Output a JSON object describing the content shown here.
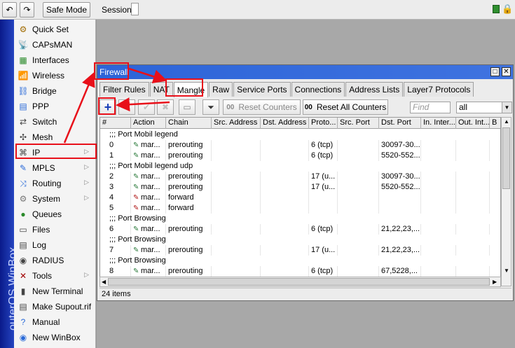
{
  "topbar": {
    "undo_icon": "undo-icon",
    "redo_icon": "redo-icon",
    "safe_mode": "Safe Mode",
    "session_label": "Session:"
  },
  "brand_vertical": "outerOS WinBox",
  "sidebar": {
    "items": [
      {
        "label": "Quick Set",
        "icon": "quickset-icon",
        "arrow": false
      },
      {
        "label": "CAPsMAN",
        "icon": "capsman-icon",
        "arrow": false
      },
      {
        "label": "Interfaces",
        "icon": "interfaces-icon",
        "arrow": false
      },
      {
        "label": "Wireless",
        "icon": "wireless-icon",
        "arrow": false
      },
      {
        "label": "Bridge",
        "icon": "bridge-icon",
        "arrow": false
      },
      {
        "label": "PPP",
        "icon": "ppp-icon",
        "arrow": false
      },
      {
        "label": "Switch",
        "icon": "switch-icon",
        "arrow": false
      },
      {
        "label": "Mesh",
        "icon": "mesh-icon",
        "arrow": false
      },
      {
        "label": "IP",
        "icon": "ip-icon",
        "arrow": true
      },
      {
        "label": "MPLS",
        "icon": "mpls-icon",
        "arrow": true
      },
      {
        "label": "Routing",
        "icon": "routing-icon",
        "arrow": true
      },
      {
        "label": "System",
        "icon": "system-icon",
        "arrow": true
      },
      {
        "label": "Queues",
        "icon": "queues-icon",
        "arrow": false
      },
      {
        "label": "Files",
        "icon": "files-icon",
        "arrow": false
      },
      {
        "label": "Log",
        "icon": "log-icon",
        "arrow": false
      },
      {
        "label": "RADIUS",
        "icon": "radius-icon",
        "arrow": false
      },
      {
        "label": "Tools",
        "icon": "tools-icon",
        "arrow": true
      },
      {
        "label": "New Terminal",
        "icon": "terminal-icon",
        "arrow": false
      },
      {
        "label": "Make Supout.rif",
        "icon": "supout-icon",
        "arrow": false
      },
      {
        "label": "Manual",
        "icon": "manual-icon",
        "arrow": false
      },
      {
        "label": "New WinBox",
        "icon": "winbox-icon",
        "arrow": false
      }
    ]
  },
  "window": {
    "title": "Firewall",
    "tabs": [
      "Filter Rules",
      "NAT",
      "Mangle",
      "Raw",
      "Service Ports",
      "Connections",
      "Address Lists",
      "Layer7 Protocols"
    ],
    "active_tab": "Mangle",
    "toolbar": {
      "reset_counters": "Reset Counters",
      "reset_all_counters": "Reset All Counters",
      "counter_prefix": "00",
      "find_placeholder": "Find",
      "chain_filter": "all"
    },
    "columns": [
      "#",
      "Action",
      "Chain",
      "Src. Address",
      "Dst. Address",
      "Proto...",
      "Src. Port",
      "Dst. Port",
      "In. Inter...",
      "Out. Int...",
      "B"
    ],
    "rows": [
      {
        "comment": ";;; Port Mobil legend"
      },
      {
        "num": "0",
        "action": "mar...",
        "chain": "prerouting",
        "proto": "6 (tcp)",
        "dst_port": "30097-30...",
        "icon": "enabled"
      },
      {
        "num": "1",
        "action": "mar...",
        "chain": "prerouting",
        "proto": "6 (tcp)",
        "dst_port": "5520-552...",
        "icon": "enabled"
      },
      {
        "comment": ";;; Port Mobil legend udp"
      },
      {
        "num": "2",
        "action": "mar...",
        "chain": "prerouting",
        "proto": "17 (u...",
        "dst_port": "30097-30...",
        "icon": "enabled"
      },
      {
        "num": "3",
        "action": "mar...",
        "chain": "prerouting",
        "proto": "17 (u...",
        "dst_port": "5520-552...",
        "icon": "enabled"
      },
      {
        "num": "4",
        "action": "mar...",
        "chain": "forward",
        "proto": "",
        "dst_port": "",
        "icon": "red"
      },
      {
        "num": "5",
        "action": "mar...",
        "chain": "forward",
        "proto": "",
        "dst_port": "",
        "icon": "red"
      },
      {
        "comment": ";;; Port Browsing"
      },
      {
        "num": "6",
        "action": "mar...",
        "chain": "prerouting",
        "proto": "6 (tcp)",
        "dst_port": "21,22,23,...",
        "icon": "enabled"
      },
      {
        "comment": ";;; Port Browsing"
      },
      {
        "num": "7",
        "action": "mar...",
        "chain": "prerouting",
        "proto": "17 (u...",
        "dst_port": "21,22,23,...",
        "icon": "enabled"
      },
      {
        "comment": ";;; Port Browsing"
      },
      {
        "num": "8",
        "action": "mar...",
        "chain": "prerouting",
        "proto": "6 (tcp)",
        "dst_port": "67,5228,...",
        "icon": "enabled"
      }
    ],
    "status": "24 items"
  },
  "colors": {
    "highlight": "#e8101a",
    "titlebar": "#2c64d8",
    "sidebar_brand": "#1a2fa8"
  }
}
